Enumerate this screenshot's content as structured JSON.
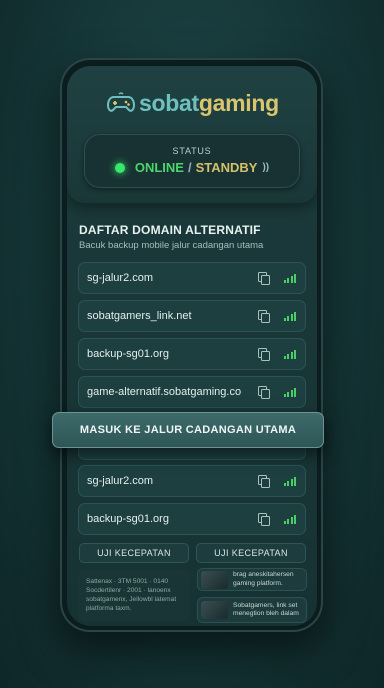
{
  "app": {
    "brand_part1": "sobat",
    "brand_part2": "gaming"
  },
  "status": {
    "label": "STATUS",
    "online": "ONLINE",
    "separator": "/",
    "standby": "STANDBY"
  },
  "domains": {
    "title": "DAFTAR DOMAIN ALTERNATIF",
    "subtitle": "Bacuk backup mobile jalur cadangan utama",
    "items": [
      "sg-jalur2.com",
      "sobatgamers_link.net",
      "backup-sg01.org",
      "game-alternatif.sobatgaming.co",
      "sg-jalur2.com",
      "backup-sg01.org"
    ]
  },
  "cta": {
    "label": "MASUK KE JALUR CADANGAN UTAMA"
  },
  "speed_buttons": [
    "UJI KECEPATAN",
    "UJI KECEPATAN"
  ],
  "info": {
    "lines": [
      "Sattenax · 3TM 5001 · 0140",
      "Socdertilenr · 2001 · lanoenx",
      "sobatgamenx, Jellowbl latemat",
      "platforma taxm."
    ]
  },
  "cards": [
    {
      "text1": "brag aneskitahersen",
      "text2": "gaming platform."
    },
    {
      "text1": "Sobatgamers, link set",
      "text2": "menegtion bleh dalam"
    }
  ],
  "colors": {
    "online": "#4cd56b",
    "standby": "#d4c06a",
    "accent_teal": "#6fc0bd",
    "accent_gold": "#d9c56f"
  }
}
